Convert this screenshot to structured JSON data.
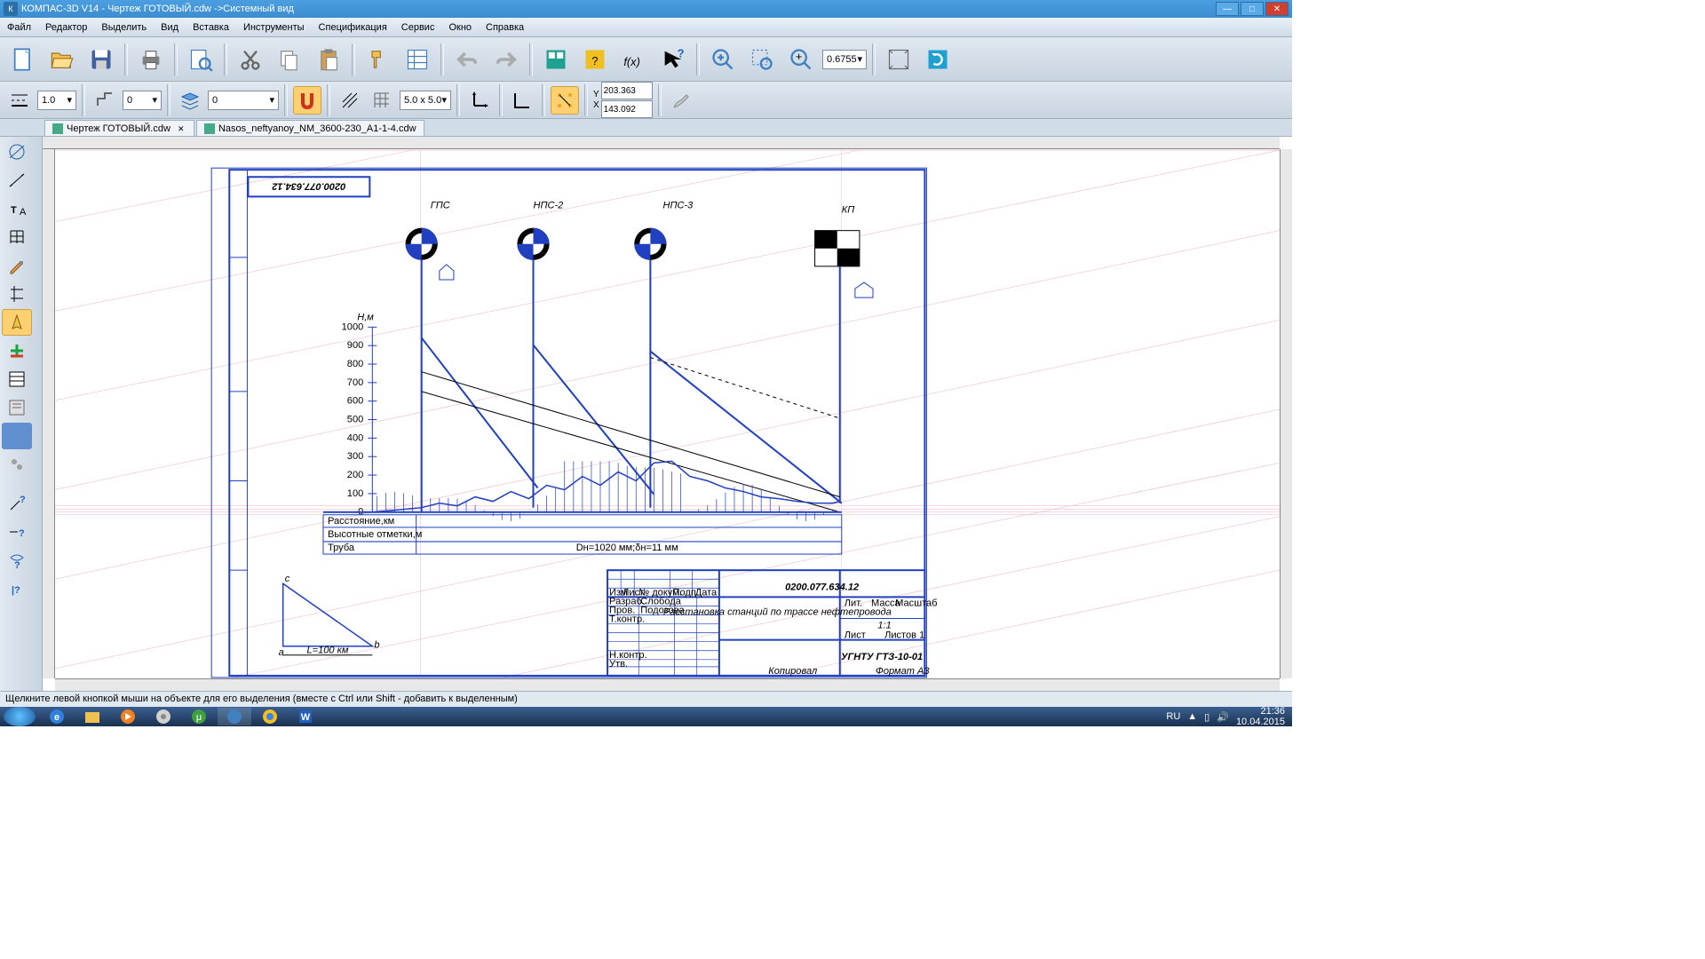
{
  "window": {
    "title": "КОМПАС-3D V14 - Чертеж ГОТОВЫЙ.cdw ->Системный вид"
  },
  "menu": [
    "Файл",
    "Редактор",
    "Выделить",
    "Вид",
    "Вставка",
    "Инструменты",
    "Спецификация",
    "Сервис",
    "Окно",
    "Справка"
  ],
  "tabs": [
    {
      "label": "Чертеж ГОТОВЫЙ.cdw",
      "active": true
    },
    {
      "label": "Nasos_neftyanoy_NM_3600-230_A1-1-4.cdw",
      "active": false
    }
  ],
  "toolbar2": {
    "lineWidth": "1.0",
    "offset": "0",
    "layer": "0",
    "grid": "5.0 x 5.0"
  },
  "coords": {
    "x": "203.363",
    "y": "143.092"
  },
  "zoom": "0.6755",
  "status": "Щелкните левой кнопкой мыши на объекте для его выделения (вместе с Ctrl или Shift - добавить к выделенным)",
  "drawing": {
    "code": "0200.077.634.12",
    "code_mirror": "0200.077.634.12",
    "stations": [
      "ГПС",
      "НПС-2",
      "НПС-3",
      "КП"
    ],
    "yaxis_label": "Н,м",
    "yaxis": [
      "1000",
      "900",
      "800",
      "700",
      "600",
      "500",
      "400",
      "300",
      "200",
      "100",
      "0"
    ],
    "table_rows": [
      "Расстояние,км",
      "Высотные отметки,м",
      "Труба"
    ],
    "pipe": "Dн=1020 мм;δн=11 мм",
    "triangle": {
      "a": "a",
      "b": "b",
      "c": "c",
      "L": "L=100 км"
    },
    "stamp": {
      "title": "Расстановка станций по трассе нефтепровода",
      "scale": "1:1",
      "org": "УГНТУ ГТЗ-10-01",
      "cols": [
        "Изм",
        "Лист",
        "№ докум.",
        "Подп.",
        "Дата"
      ],
      "rows": [
        "Разраб.",
        "Пров.",
        "Т.контр.",
        "",
        "Н.контр.",
        "Утв."
      ],
      "names": [
        "Слобода",
        "Подозова"
      ],
      "right": [
        "Лит.",
        "Масса",
        "Масштаб",
        "Лист",
        "Листов 1"
      ],
      "bottom": [
        "Копировал",
        "Формат А3"
      ]
    }
  },
  "tray": {
    "lang": "RU",
    "time": "21:36",
    "date": "10.04.2015"
  }
}
